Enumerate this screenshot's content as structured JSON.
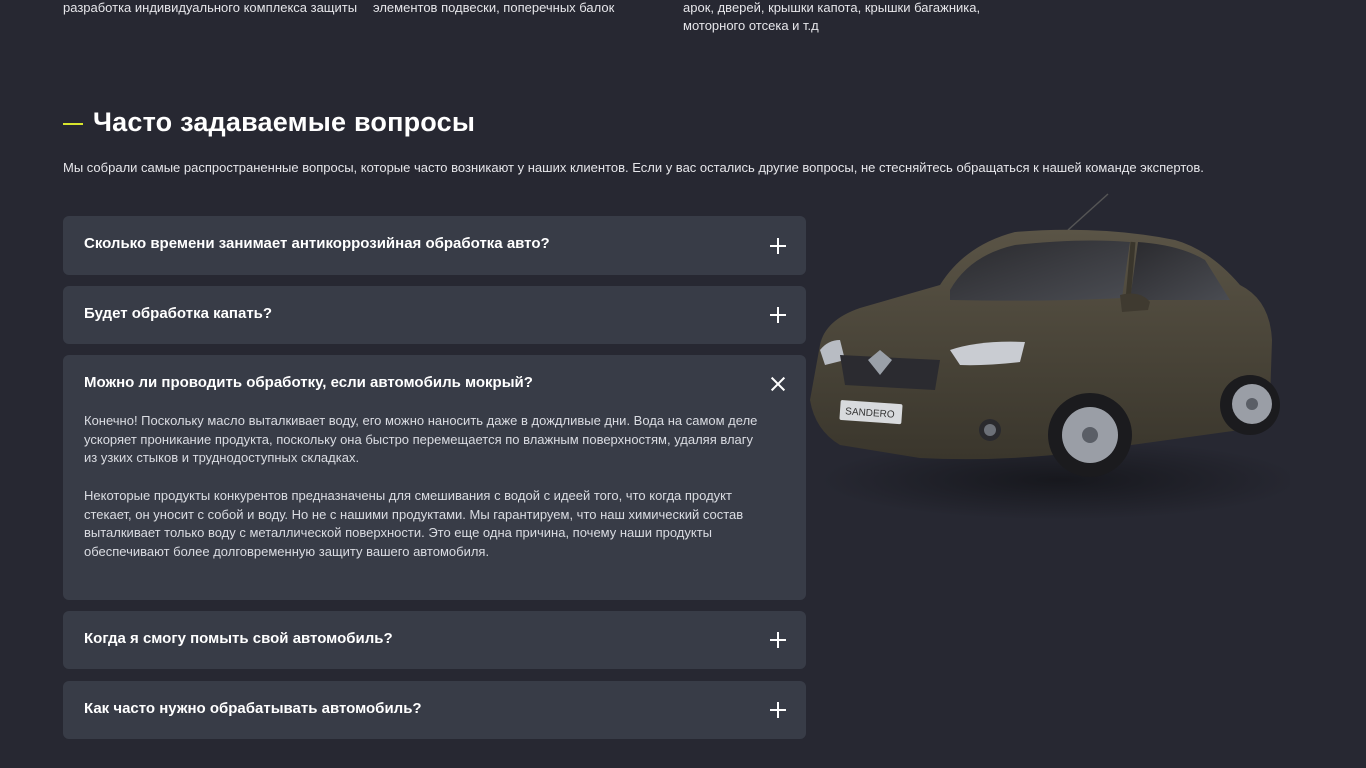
{
  "top_columns": [
    {
      "text": "разработка индивидуального комплекса защиты"
    },
    {
      "text": "элементов подвески, поперечных балок"
    },
    {
      "text": "арок, дверей, крышки капота, крышки багажника, моторного отсека и т.д"
    }
  ],
  "faq_section": {
    "title": "Часто задаваемые вопросы",
    "intro": "Мы собрали самые распространенные вопросы, которые часто возникают у наших клиентов. Если у вас остались другие вопросы, не стесняйтесь обращаться к нашей команде экспертов.",
    "items": [
      {
        "question": "Сколько времени занимает антикоррозийная обработка авто?",
        "state": "collapsed",
        "toggle_icon": "plus-icon"
      },
      {
        "question": "Будет обработка капать?",
        "state": "collapsed",
        "toggle_icon": "plus-icon"
      },
      {
        "question": "Можно ли проводить обработку, если автомобиль мокрый?",
        "state": "expanded",
        "toggle_icon": "close-icon",
        "answer_p1": "Конечно! Поскольку масло выталкивает воду, его можно наносить даже в дождливые дни. Вода на самом деле ускоряет проникание продукта, поскольку она быстро перемещается по влажным поверхностям, удаляя влагу из узких стыков и труднодоступных складках.",
        "answer_p2": "Некоторые продукты конкурентов предназначены для смешивания с водой с идеей того, что когда продукт стекает, он уносит с собой и воду. Но не с нашими продуктами. Мы гарантируем, что наш химический состав выталкивает только воду с металлической поверхности. Это еще одна причина, почему наши продукты обеспечивают более долговременную защиту вашего автомобиля."
      },
      {
        "question": "Когда я смогу помыть свой автомобиль?",
        "state": "collapsed",
        "toggle_icon": "plus-icon"
      },
      {
        "question": "Как часто нужно обрабатывать автомобиль?",
        "state": "collapsed",
        "toggle_icon": "plus-icon"
      }
    ]
  },
  "car_image": {
    "plate_text": "SANDERO"
  },
  "colors": {
    "background": "#272832",
    "card": "#383c47",
    "accent": "#d8e52d",
    "car_body": "#4a4538"
  }
}
